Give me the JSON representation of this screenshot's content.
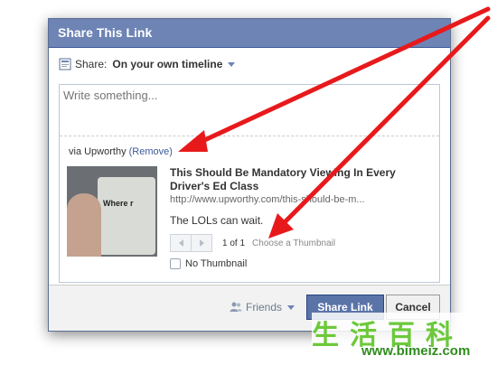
{
  "dialog": {
    "title": "Share This Link",
    "share_label": "Share:",
    "share_target": "On your own timeline",
    "compose_placeholder": "Write something...",
    "via_text": "via Upworthy",
    "remove_link": "(Remove)",
    "link_title": "This Should Be Mandatory Viewing In Every Driver's Ed Class",
    "link_url": "http://www.upworthy.com/this-should-be-m...",
    "link_description": "The LOLs can wait.",
    "pager_count": "1 of 1",
    "choose_thumbnail": "Choose a Thumbnail",
    "no_thumbnail": "No Thumbnail",
    "thumbnail_screen_text": "Where r",
    "privacy": "Friends",
    "share_button": "Share Link",
    "cancel_button": "Cancel"
  },
  "watermark": {
    "chars": "生活百科",
    "url": "www.bimeiz.com"
  },
  "colors": {
    "titlebar": "#6d84b4",
    "primary_button": "#5b74a8",
    "arrow": "#e8191b",
    "link": "#3b5998"
  }
}
